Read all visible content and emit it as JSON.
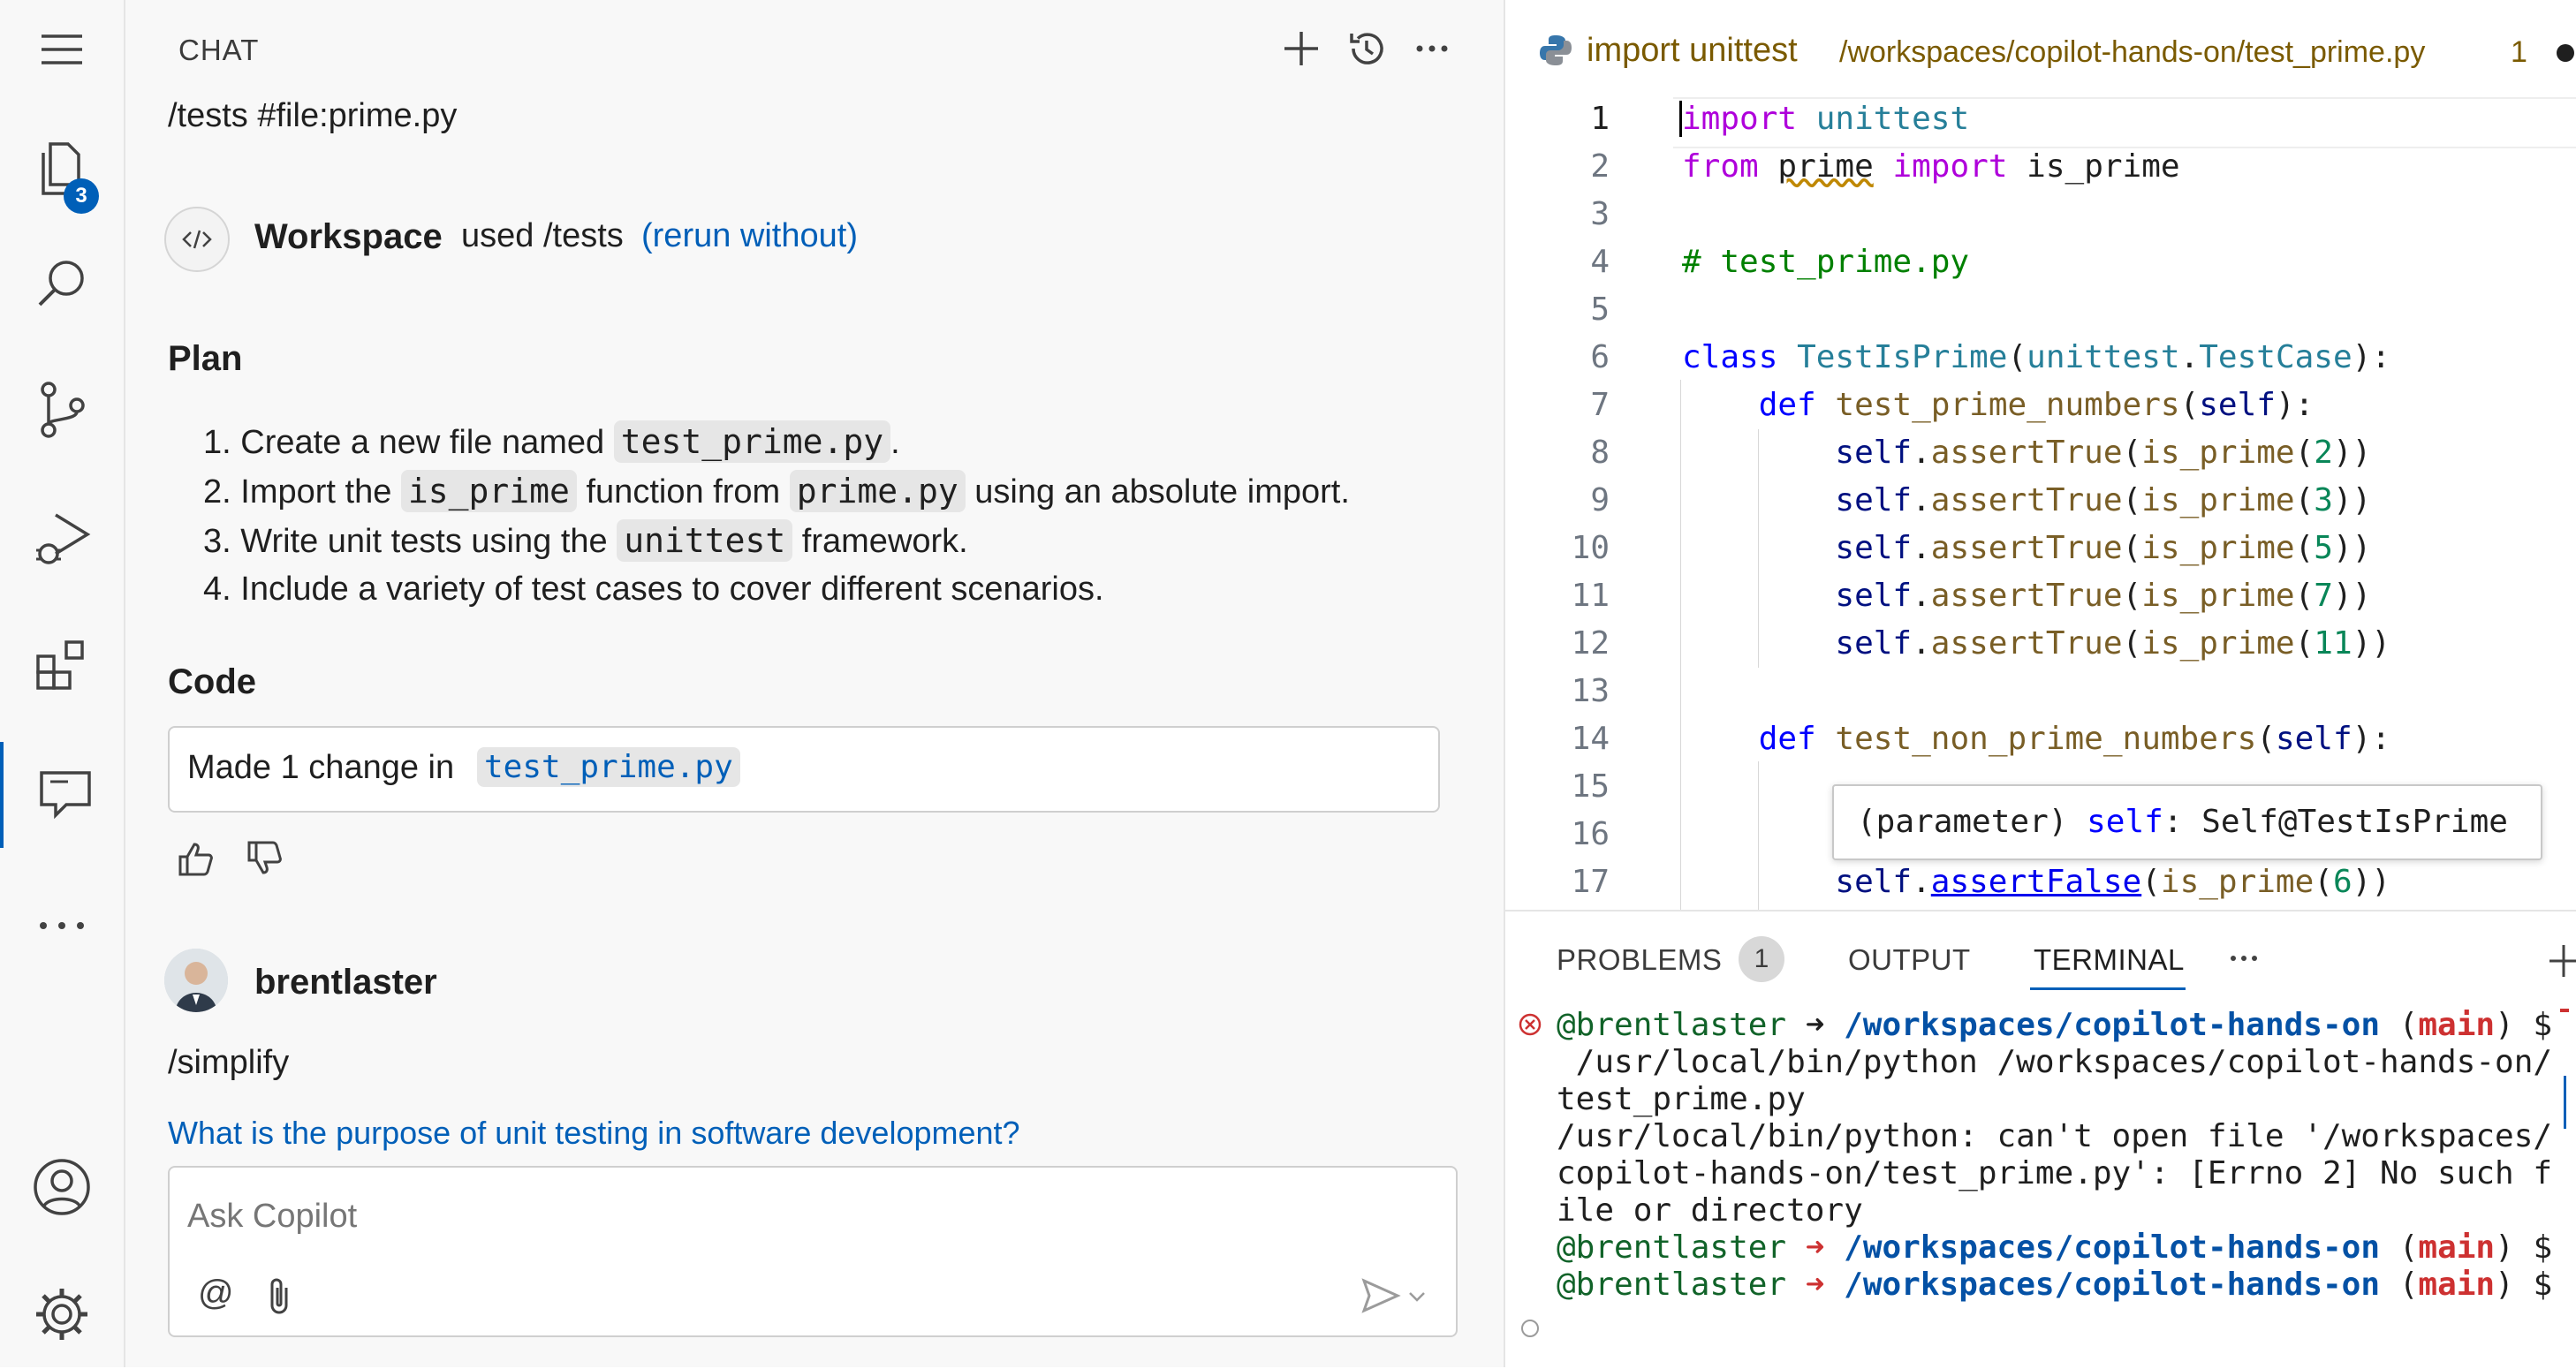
{
  "activity_bar": {
    "items": [
      {
        "name": "explorer",
        "icon": "files-icon",
        "badge": "3"
      },
      {
        "name": "search",
        "icon": "search-icon"
      },
      {
        "name": "source-control",
        "icon": "source-control-icon"
      },
      {
        "name": "run-debug",
        "icon": "run-debug-icon"
      },
      {
        "name": "extensions",
        "icon": "extensions-icon"
      },
      {
        "name": "chat",
        "icon": "chat-icon"
      },
      {
        "name": "more",
        "icon": "ellipsis-icon"
      }
    ],
    "bottom": [
      {
        "name": "accounts",
        "icon": "account-icon"
      },
      {
        "name": "manage",
        "icon": "gear-icon"
      }
    ]
  },
  "chat": {
    "title": "CHAT",
    "previous_prompt": "/tests #file:prime.py",
    "participant": "Workspace",
    "used_text": "used /tests",
    "rerun_text": "(rerun without)",
    "plan_heading": "Plan",
    "plan": [
      {
        "num": "1.",
        "parts": [
          "Create a new file named ",
          "test_prime.py",
          "."
        ]
      },
      {
        "num": "2.",
        "parts": [
          "Import the ",
          "is_prime",
          " function from ",
          "prime.py",
          " using an absolute import."
        ]
      },
      {
        "num": "3.",
        "parts": [
          "Write unit tests using the ",
          "unittest",
          " framework."
        ]
      },
      {
        "num": "4.",
        "parts": [
          "Include a variety of test cases to cover different scenarios."
        ]
      }
    ],
    "code_heading": "Code",
    "made_change_text": "Made 1 change in",
    "changed_file": "test_prime.py",
    "user_name": "brentlaster",
    "user_prompt": "/simplify",
    "suggestion": "What is the purpose of unit testing in software development?",
    "input_placeholder": "Ask Copilot",
    "mention_symbol": "@"
  },
  "editor": {
    "tab_title": "import unittest",
    "tab_path": "/workspaces/copilot-hands-on/test_prime.py",
    "tab_problem_count": "1",
    "line_numbers": [
      "1",
      "2",
      "3",
      "4",
      "5",
      "6",
      "7",
      "8",
      "9",
      "10",
      "11",
      "12",
      "13",
      "14",
      "15",
      "16",
      "17"
    ],
    "hover_text_param": "(parameter)",
    "hover_text_self": "self",
    "hover_text_type": ": Self@TestIsPrime"
  },
  "panel": {
    "tabs": [
      "PROBLEMS",
      "OUTPUT",
      "TERMINAL"
    ],
    "problems_count": "1",
    "active_tab": "TERMINAL",
    "terminal_lines": [
      "@brentlaster ➜ /workspaces/copilot-hands-on (main) $",
      " /usr/local/bin/python /workspaces/copilot-hands-on/",
      "test_prime.py",
      "/usr/local/bin/python: can't open file '/workspaces/",
      "copilot-hands-on/test_prime.py': [Errno 2] No such f",
      "ile or directory",
      "@brentlaster ➜ /workspaces/copilot-hands-on (main) $",
      "@brentlaster ➜ /workspaces/copilot-hands-on (main) $"
    ]
  },
  "colors": {
    "accent": "#005fb8",
    "keyword": "#0000ff",
    "import_keyword": "#af00db",
    "function": "#795e26",
    "number": "#098658",
    "comment": "#008000",
    "terminal_error": "#cd3131"
  }
}
